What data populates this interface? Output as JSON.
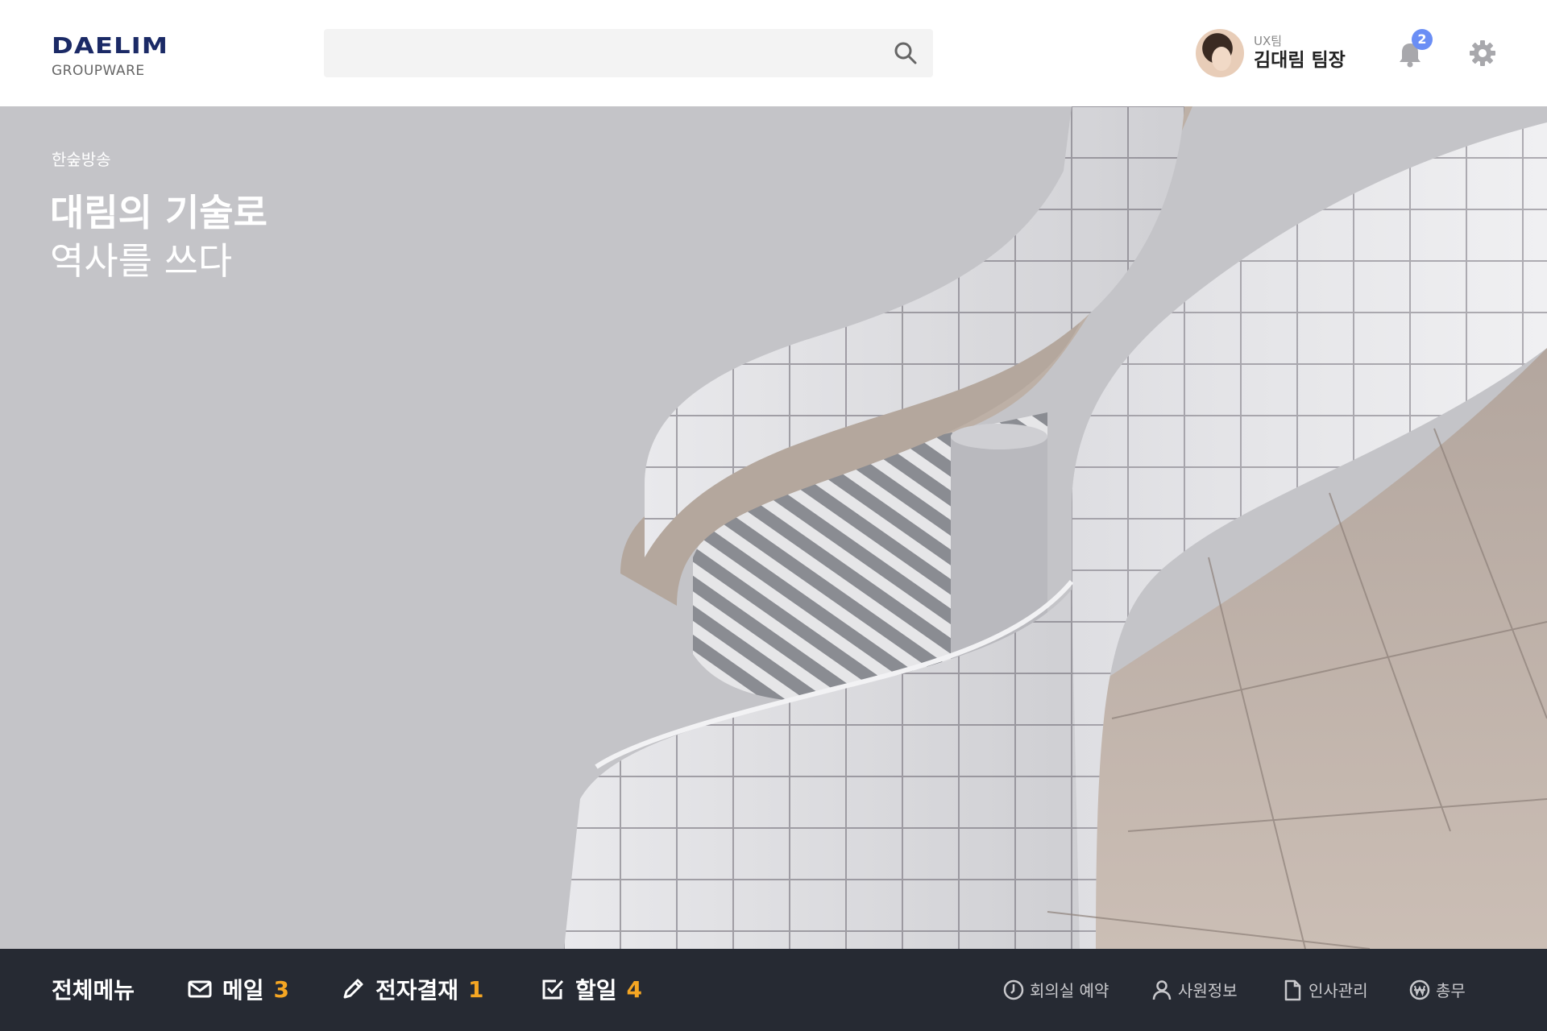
{
  "header": {
    "logo": {
      "brand": "DAELIM",
      "sub": "GROUPWARE"
    },
    "search": {
      "placeholder": ""
    },
    "profile": {
      "team": "UX팀",
      "name": "김대림 팀장"
    },
    "notifications": {
      "count": "2"
    }
  },
  "hero": {
    "subtitle": "한숲방송",
    "title_line1": "대림의 기술로",
    "title_line2": "역사를 쓰다"
  },
  "bottombar": {
    "all_menu": "전체메뉴",
    "quick": [
      {
        "icon": "mail-icon",
        "label": "메일",
        "count": "3"
      },
      {
        "icon": "pencil-icon",
        "label": "전자결재",
        "count": "1"
      },
      {
        "icon": "checkbox-icon",
        "label": "할일",
        "count": "4"
      }
    ],
    "shortcuts": [
      {
        "icon": "clock-icon",
        "label": "회의실 예약"
      },
      {
        "icon": "person-icon",
        "label": "사원정보"
      },
      {
        "icon": "document-icon",
        "label": "인사관리"
      },
      {
        "icon": "won-icon",
        "label": "총무"
      }
    ]
  },
  "colors": {
    "brand": "#1b2a66",
    "bar_bg": "#262a33",
    "count": "#f5a623",
    "badge": "#6a8ef5"
  }
}
